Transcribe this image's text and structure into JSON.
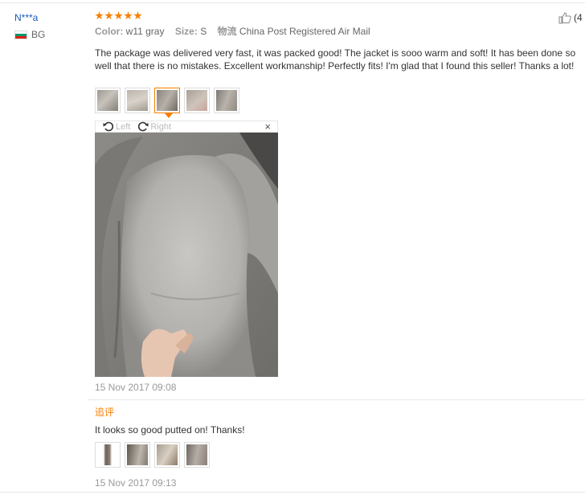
{
  "user": {
    "name": "N***a",
    "country": "BG"
  },
  "rating": {
    "stars": 5
  },
  "order": {
    "color_label": "Color:",
    "color_value": "w11 gray",
    "size_label": "Size:",
    "size_value": "S",
    "shipping_label": "物流",
    "shipping_value": "China Post Registered Air Mail"
  },
  "helpful": {
    "count": "(4"
  },
  "review": {
    "text": "The package was delivered very fast, it was packed good! The jacket is sooo warm and soft! It has been done so well that there is no mistakes. Excellent workmanship! Perfectly fits! I'm glad that I found this seller! Thanks a lot!",
    "date": "15 Nov 2017 09:08"
  },
  "viewer": {
    "rotate_left": "Left",
    "rotate_right": "Right",
    "close": "×"
  },
  "followup": {
    "label": "追评",
    "text": "It looks so good putted on! Thanks!",
    "date": "15 Nov 2017 09:13"
  },
  "colors": {
    "accent": "#f77f00",
    "username": "#1a5bb8",
    "muted": "#999999"
  }
}
